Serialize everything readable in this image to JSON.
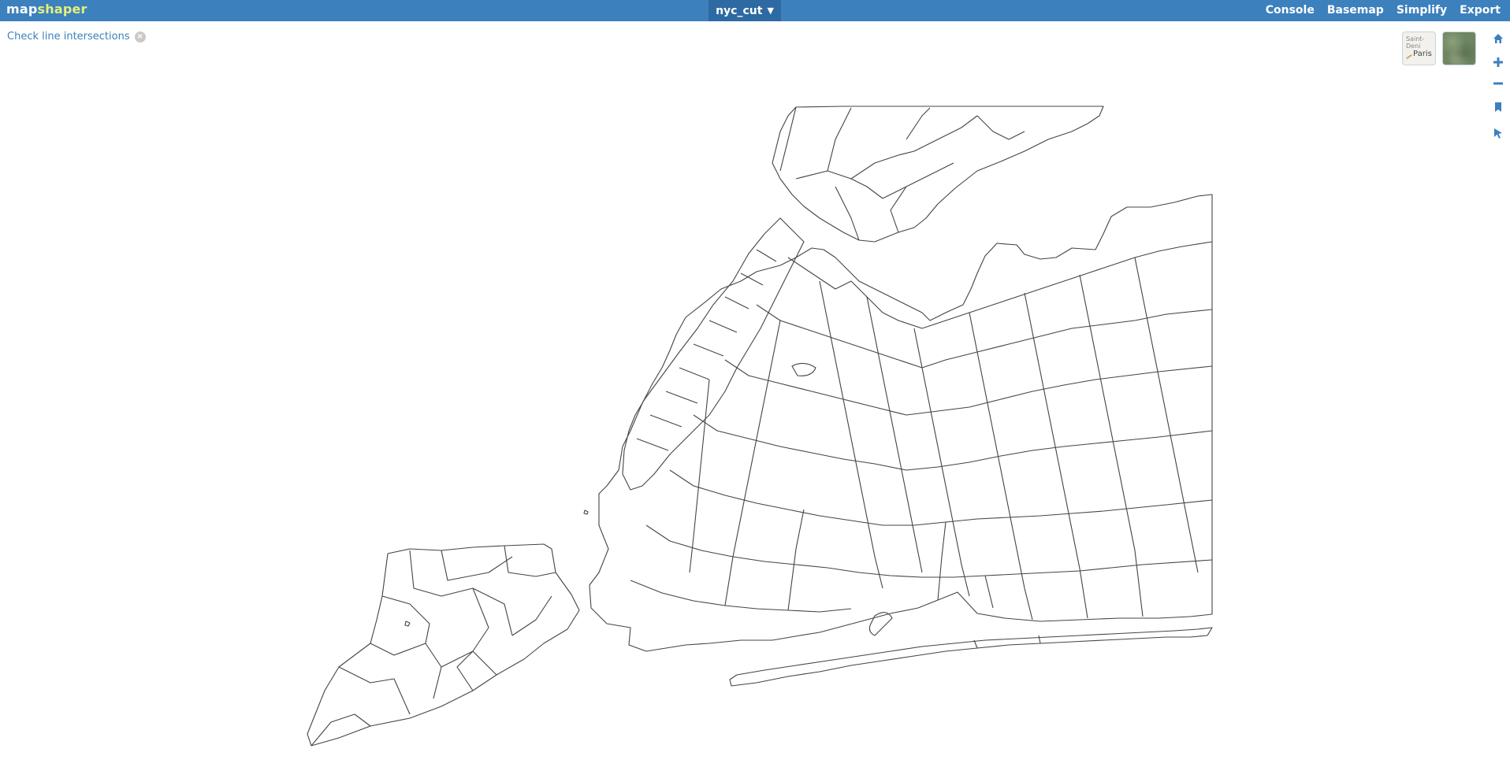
{
  "app": {
    "logo_part1": "map",
    "logo_part2": "shaper"
  },
  "layer_menu": {
    "label": "nyc_cut",
    "arrow": "▼"
  },
  "nav": {
    "items": [
      "Console",
      "Basemap",
      "Simplify",
      "Export"
    ]
  },
  "intersections": {
    "label": "Check line intersections",
    "close_icon": "close-icon"
  },
  "basemap_thumbs": {
    "street_small": "Saint-Deni",
    "street_city": "Paris"
  },
  "toolbar_icons": [
    "home-icon",
    "zoom-in-icon",
    "zoom-out-icon",
    "bookmark-icon",
    "pointer-icon"
  ],
  "colors": {
    "bar": "#3c80bd",
    "bar_active": "#2d6aa3",
    "logo_accent": "#e3f07a",
    "map_stroke": "#444444"
  }
}
